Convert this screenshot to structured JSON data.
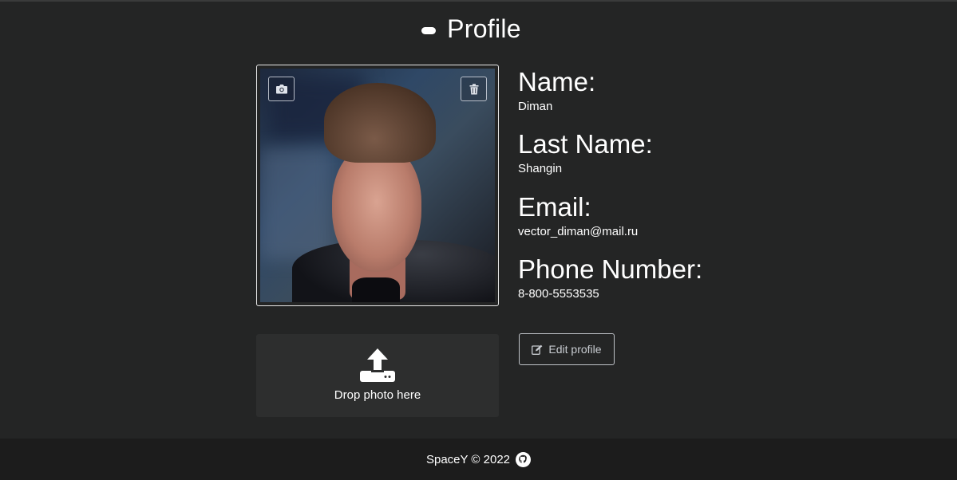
{
  "header": {
    "title": "Profile"
  },
  "photo": {
    "upload_button_icon": "camera-icon",
    "delete_button_icon": "trash-icon"
  },
  "fields": [
    {
      "label": "Name:",
      "value": "Diman"
    },
    {
      "label": "Last Name:",
      "value": "Shangin"
    },
    {
      "label": "Email:",
      "value": "vector_diman@mail.ru"
    },
    {
      "label": "Phone Number:",
      "value": "8-800-5553535"
    }
  ],
  "dropzone": {
    "icon": "upload-icon",
    "text": "Drop photo here"
  },
  "actions": {
    "edit_label": "Edit profile",
    "edit_icon": "edit-icon"
  },
  "footer": {
    "text": "SpaceY © 2022",
    "icon": "github-icon"
  }
}
